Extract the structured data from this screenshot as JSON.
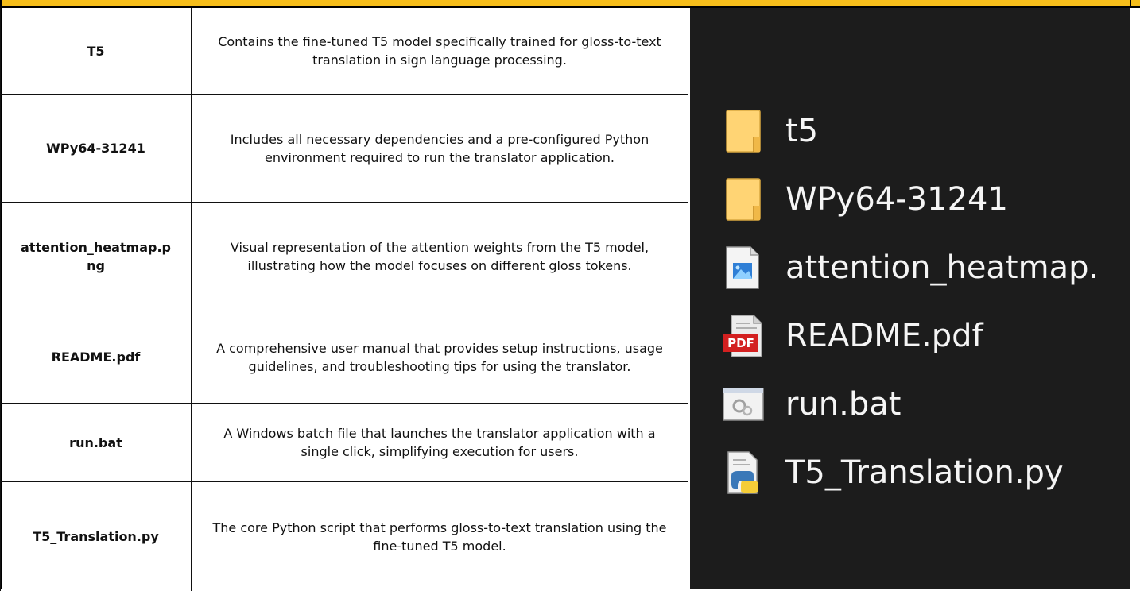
{
  "table": {
    "rows": [
      {
        "name": "T5",
        "description": "Contains the fine-tuned T5 model specifically trained for gloss-to-text translation in sign language processing."
      },
      {
        "name": "WPy64-31241",
        "description": "Includes all necessary dependencies and a pre-configured Python environment required to run the translator application."
      },
      {
        "name": "attention_heatmap.png",
        "description": "Visual representation of the attention weights from the T5 model, illustrating how the model focuses on different gloss tokens."
      },
      {
        "name": "README.pdf",
        "description": "A comprehensive user manual that provides setup instructions, usage guidelines, and troubleshooting tips for using the translator."
      },
      {
        "name": "run.bat",
        "description": "A Windows batch file that launches the translator application with a single click, simplifying execution for users."
      },
      {
        "name": "T5_Translation.py",
        "description": "The core Python script that performs gloss-to-text translation using the fine-tuned T5 model."
      }
    ]
  },
  "explorer": {
    "items": [
      {
        "name": "t5",
        "icon": "folder-icon"
      },
      {
        "name": "WPy64-31241",
        "icon": "folder-icon"
      },
      {
        "name": "attention_heatmap.",
        "icon": "image-file-icon"
      },
      {
        "name": "README.pdf",
        "icon": "pdf-file-icon",
        "badge": "PDF"
      },
      {
        "name": "run.bat",
        "icon": "batch-file-icon"
      },
      {
        "name": "T5_Translation.py",
        "icon": "python-file-icon"
      }
    ]
  },
  "colors": {
    "accent_bar": "#f6be1b",
    "explorer_bg": "#1c1c1c",
    "folder": "#ffd474",
    "pdf_red": "#d32020"
  }
}
